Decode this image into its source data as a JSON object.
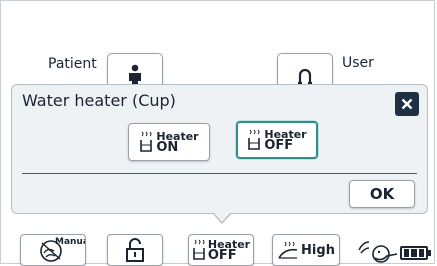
{
  "top": {
    "patient_label": "Patient",
    "user_label": "User"
  },
  "dialog": {
    "title": "Water heater (Cup)",
    "options": [
      {
        "line1": "Heater",
        "line2": "ON",
        "selected": false
      },
      {
        "line1": "Heater",
        "line2": "OFF",
        "selected": true
      }
    ],
    "ok_label": "OK",
    "close_icon": "close-icon"
  },
  "toolbar": {
    "manual_label": "Manual",
    "heater_line1": "Heater",
    "heater_line2": "OFF",
    "flow_label": "High"
  },
  "colors": {
    "dialog_bg": "#eef2f5",
    "selected_border": "#2f8d8b",
    "close_bg": "#1f3045",
    "divider": "#2f5d8a"
  }
}
